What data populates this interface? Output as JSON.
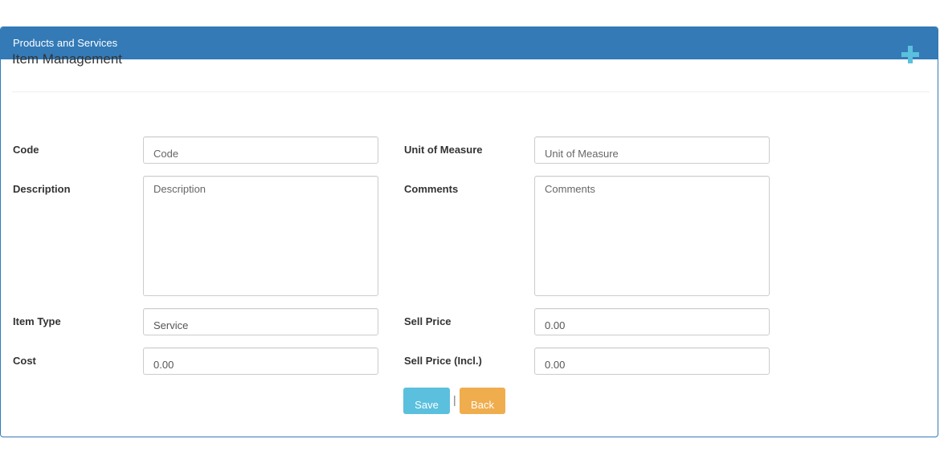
{
  "panel": {
    "heading": "Products and Services",
    "section_title": "Item Management",
    "add_icon": "plus-icon",
    "accent_color": "#337ab7"
  },
  "form": {
    "code": {
      "label": "Code",
      "placeholder": "Code",
      "value": ""
    },
    "unit_of_measure": {
      "label": "Unit of Measure",
      "placeholder": "Unit of Measure",
      "value": ""
    },
    "description": {
      "label": "Description",
      "placeholder": "Description",
      "value": ""
    },
    "comments": {
      "label": "Comments",
      "placeholder": "Comments",
      "value": ""
    },
    "item_type": {
      "label": "Item Type",
      "placeholder": "",
      "value": "Service"
    },
    "sell_price": {
      "label": "Sell Price",
      "placeholder": "",
      "value": "0.00"
    },
    "cost": {
      "label": "Cost",
      "placeholder": "",
      "value": "0.00"
    },
    "sell_price_incl": {
      "label": "Sell Price (Incl.)",
      "placeholder": "",
      "value": "0.00"
    }
  },
  "actions": {
    "save_label": "Save",
    "separator": "|",
    "back_label": "Back",
    "save_color": "#5bc0de",
    "back_color": "#f0ad4e"
  }
}
